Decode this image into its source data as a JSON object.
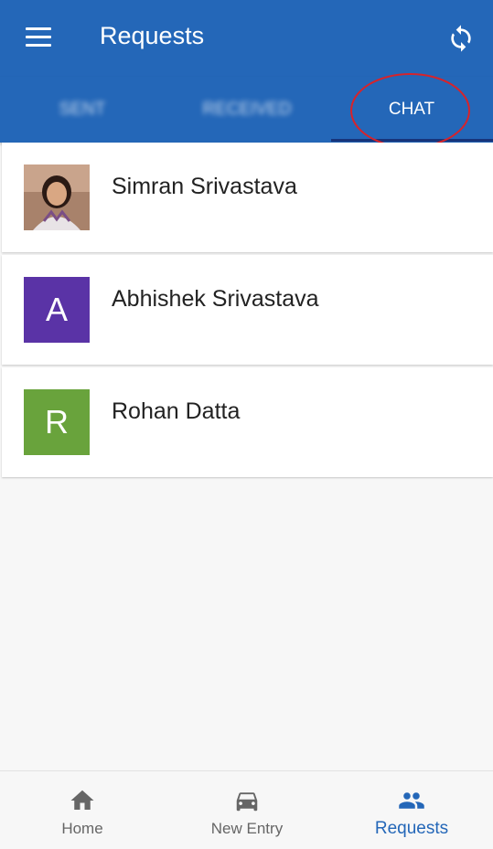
{
  "appbar": {
    "title": "Requests"
  },
  "tabs": [
    {
      "label": "SENT"
    },
    {
      "label": "RECEIVED"
    },
    {
      "label": "CHAT"
    }
  ],
  "contacts": [
    {
      "name": "Simran Srivastava",
      "initial": "",
      "avatar_color": "#b9967a"
    },
    {
      "name": "Abhishek Srivastava",
      "initial": "A",
      "avatar_color": "#5a33a6"
    },
    {
      "name": "Rohan Datta",
      "initial": "R",
      "avatar_color": "#69a33c"
    }
  ],
  "bottom_nav": [
    {
      "label": "Home"
    },
    {
      "label": "New Entry"
    },
    {
      "label": "Requests"
    }
  ],
  "colors": {
    "primary": "#2467b8",
    "active_indicator": "#17347a",
    "annotation": "#d8232a"
  },
  "icons": [
    "menu-icon",
    "sync-icon",
    "home-icon",
    "car-icon",
    "people-icon"
  ]
}
